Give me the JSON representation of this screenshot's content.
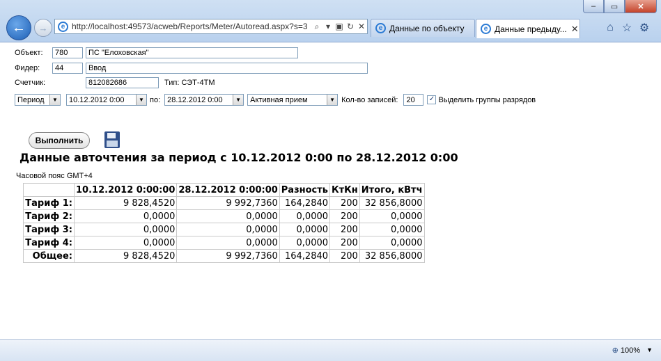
{
  "browser": {
    "address": "http://localhost:49573/acweb/Reports/Meter/Autoread.aspx?s=3",
    "address_host": "localhost",
    "tabs": [
      {
        "label": "Данные по объекту"
      },
      {
        "label": "Данные предыду..."
      }
    ],
    "zoom": "100%"
  },
  "form": {
    "object_label": "Объект:",
    "object_id": "780",
    "object_name": "ПС \"Елоховская\"",
    "feeder_label": "Фидер:",
    "feeder_id": "44",
    "feeder_name": "Ввод",
    "meter_label": "Счетчик:",
    "meter_value": "812082686",
    "meter_type": "Тип: СЭТ-4ТМ",
    "period_select": "Период",
    "date_from": "10.12.2012 0:00",
    "to_label": "по:",
    "date_to": "28.12.2012 0:00",
    "energy_type": "Активная прием",
    "count_label": "Кол-во записей:",
    "count_value": "20",
    "highlight_label": "Выделить группы разрядов",
    "highlight_checked": true
  },
  "actions": {
    "run_label": "Выполнить"
  },
  "report": {
    "title": "Данные авточтения за период с 10.12.2012 0:00 по 28.12.2012 0:00",
    "timezone": "Часовой пояс GMT+4",
    "headers": [
      "",
      "10.12.2012 0:00:00",
      "28.12.2012 0:00:00",
      "Разность",
      "КтКн",
      "Итого, кВтч"
    ],
    "rows": [
      [
        "Тариф 1:",
        "9 828,4520",
        "9 992,7360",
        "164,2840",
        "200",
        "32 856,8000"
      ],
      [
        "Тариф 2:",
        "0,0000",
        "0,0000",
        "0,0000",
        "200",
        "0,0000"
      ],
      [
        "Тариф 3:",
        "0,0000",
        "0,0000",
        "0,0000",
        "200",
        "0,0000"
      ],
      [
        "Тариф 4:",
        "0,0000",
        "0,0000",
        "0,0000",
        "200",
        "0,0000"
      ],
      [
        "Общее:",
        "9 828,4520",
        "9 992,7360",
        "164,2840",
        "200",
        "32 856,8000"
      ]
    ]
  }
}
